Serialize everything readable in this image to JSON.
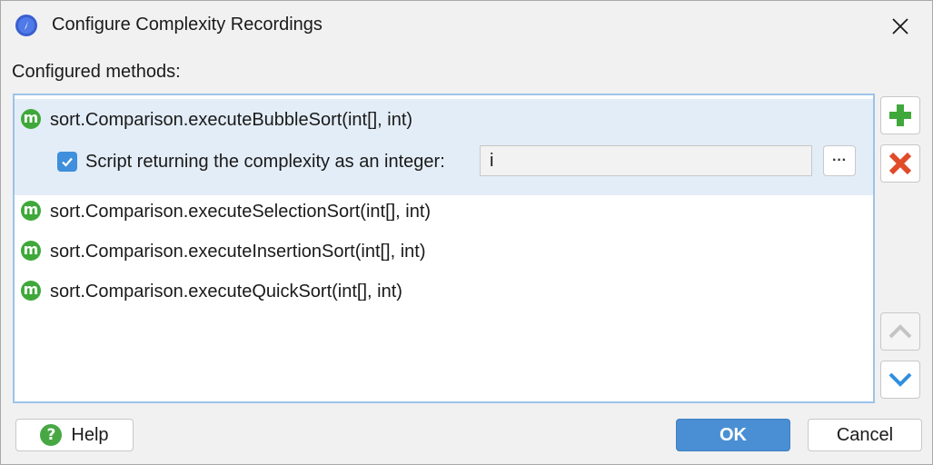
{
  "window": {
    "title": "Configure Complexity Recordings"
  },
  "list": {
    "label": "Configured methods:",
    "items": [
      {
        "label": "sort.Comparison.executeBubbleSort(int[], int)",
        "selected": true
      },
      {
        "label": "sort.Comparison.executeSelectionSort(int[], int)",
        "selected": false
      },
      {
        "label": "sort.Comparison.executeInsertionSort(int[], int)",
        "selected": false
      },
      {
        "label": "sort.Comparison.executeQuickSort(int[], int)",
        "selected": false
      }
    ],
    "method_icon_letter": "m"
  },
  "script": {
    "checked": true,
    "label": "Script returning the complexity as an integer:",
    "value": "i",
    "browse_label": "···"
  },
  "side_buttons": {
    "add_icon": "plus-icon",
    "remove_icon": "x-icon",
    "move_up_icon": "chevron-up-icon",
    "move_down_icon": "chevron-down-icon"
  },
  "buttons": {
    "help_icon_glyph": "?",
    "help": "Help",
    "ok": "OK",
    "cancel": "Cancel"
  },
  "colors": {
    "selection": "#e3edf7",
    "list_border": "#9cc3ea",
    "accent": "#4a8fd3",
    "method_icon": "#3fa83a",
    "add": "#3fa83a",
    "remove": "#e04b2a",
    "down_arrow": "#2f8fe0"
  }
}
